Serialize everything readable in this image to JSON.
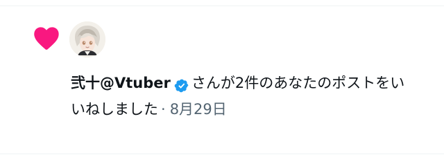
{
  "notification": {
    "type_icon": "heart-icon",
    "avatar_icon": "anime-avatar",
    "user": {
      "display_name": "弐十@Vtuber",
      "verified_icon": "verified-badge-icon"
    },
    "message_line1": "さんが2件のあなたのポストをい",
    "message_line2": "いねしました",
    "separator": "·",
    "date": "8月29日"
  },
  "colors": {
    "heart": "#f91880",
    "verified": "#1d9bf0",
    "text_primary": "#0f1419",
    "text_secondary": "#536471",
    "divider": "#eff3f4"
  }
}
